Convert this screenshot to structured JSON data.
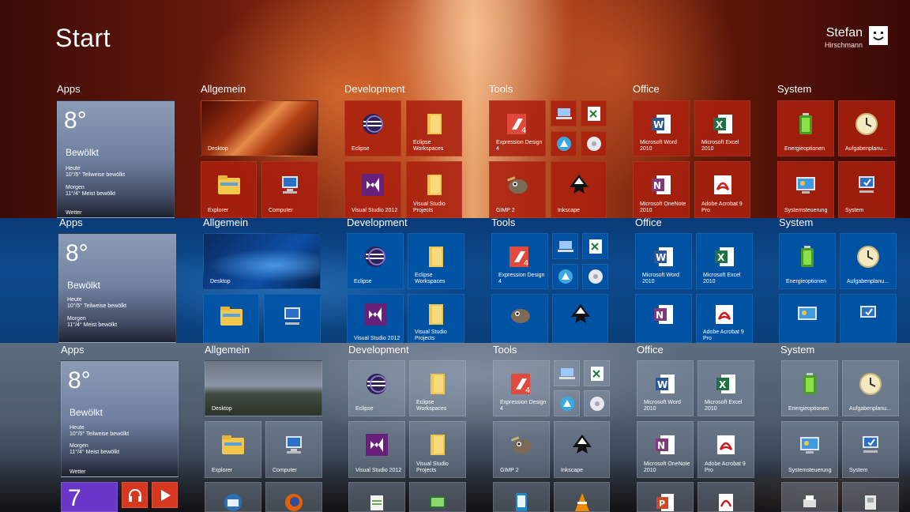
{
  "start": {
    "title": "Start"
  },
  "user": {
    "name": "Stefan",
    "surname": "Hirschmann"
  },
  "groups": {
    "apps": "Apps",
    "allgemein": "Allgemein",
    "development": "Development",
    "tools": "Tools",
    "office": "Office",
    "system": "System"
  },
  "weather": {
    "temp": "8°",
    "condition": "Bewölkt",
    "today_label": "Heute",
    "today_forecast": "10°/5° Teilweise bewölkt",
    "tomorrow_label": "Morgen",
    "tomorrow_forecast": "11°/4° Meist bewölkt",
    "app_name": "Wetter"
  },
  "tiles": {
    "desktop": "Desktop",
    "explorer": "Explorer",
    "computer": "Computer",
    "eclipse": "Eclipse",
    "eclipse_ws": "Eclipse Workspaces",
    "vs2012": "Visual Studio 2012",
    "vs_projects": "Visual Studio Projects",
    "expression": "Expression Design 4",
    "gimp": "GIMP 2",
    "inkscape": "Inkscape",
    "word": "Microsoft Word 2010",
    "excel": "Microsoft Excel 2010",
    "onenote": "Microsoft OneNote 2010",
    "acrobat": "Adobe Acrobat 9 Pro",
    "energie": "Energieoptionen",
    "aufgaben": "Aufgabenplanu...",
    "systemsteuerung": "Systemsteuerung",
    "system": "System"
  },
  "calendar": {
    "day": "7"
  },
  "colors": {
    "red_tile": "#aa200e",
    "blue_tile": "#0054a6",
    "grey_tile": "#96a5b9",
    "calendar_tile": "#6a36c8",
    "music_tile": "#d6371f"
  },
  "icons": [
    "eclipse-icon",
    "folder-icon",
    "visual-studio-icon",
    "expression-design-icon",
    "gimp-icon",
    "inkscape-icon",
    "word-icon",
    "excel-icon",
    "onenote-icon",
    "acrobat-icon",
    "battery-icon",
    "clock-icon",
    "control-panel-icon",
    "computer-icon",
    "explorer-icon",
    "headphones-icon",
    "video-icon",
    "thunderbird-icon",
    "firefox-icon"
  ]
}
